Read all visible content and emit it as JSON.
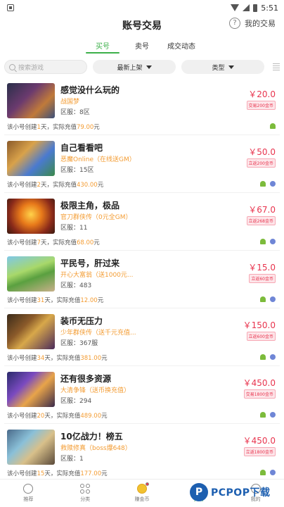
{
  "status_bar": {
    "time": "5:51"
  },
  "header": {
    "title": "账号交易",
    "help_label": "我的交易"
  },
  "tabs": [
    {
      "label": "买号",
      "active": true
    },
    {
      "label": "卖号",
      "active": false
    },
    {
      "label": "成交动态",
      "active": false
    }
  ],
  "filters": {
    "search_placeholder": "搜索游戏",
    "sort_label": "最新上架",
    "type_label": "类型"
  },
  "colors": {
    "accent": "#3cb04a",
    "price": "#e8344e",
    "highlight": "#f39c33"
  },
  "listings": [
    {
      "title": "感觉没什么玩的",
      "game": "战国梦",
      "server": "区服：8区",
      "created_a": "该小号创建",
      "days": "1",
      "created_b": "天，实际充值",
      "recharge": "79.00",
      "created_c": "元",
      "price": "￥20.0",
      "coins": "交易200金币",
      "android": true,
      "ios": false
    },
    {
      "title": "自己看看吧",
      "game": "恶魔Online（在线送GM）",
      "server": "区服：15区",
      "created_a": "该小号创建",
      "days": "2",
      "created_b": "天，实际充值",
      "recharge": "430.00",
      "created_c": "元",
      "price": "￥50.0",
      "coins": "立返200金币",
      "android": true,
      "ios": true
    },
    {
      "title": "极限主角，极品",
      "game": "官刀群侠传（0元全GM）",
      "server": "区服：11",
      "created_a": "该小号创建",
      "days": "7",
      "created_b": "天，实际充值",
      "recharge": "68.00",
      "created_c": "元",
      "price": "￥67.0",
      "coins": "立返268金币",
      "android": true,
      "ios": true
    },
    {
      "title": "平民号，肝过来",
      "game": "开心大富翁（送1000元...",
      "server": "区服：483",
      "created_a": "该小号创建",
      "days": "31",
      "created_b": "天，实际充值",
      "recharge": "12.00",
      "created_c": "元",
      "price": "￥15.0",
      "coins": "立返60金币",
      "android": true,
      "ios": true
    },
    {
      "title": "装币无压力",
      "game": "少年群侠传（送千元充值...",
      "server": "区服：367服",
      "created_a": "该小号创建",
      "days": "34",
      "created_b": "天，实际充值",
      "recharge": "381.00",
      "created_c": "元",
      "price": "￥150.0",
      "coins": "立返600金币",
      "android": true,
      "ios": true
    },
    {
      "title": "还有很多资源",
      "game": "大清争锋（送币换充值）",
      "server": "区服：294",
      "created_a": "该小号创建",
      "days": "20",
      "created_b": "天，实际充值",
      "recharge": "489.00",
      "created_c": "元",
      "price": "￥450.0",
      "coins": "交易1800金币",
      "android": true,
      "ios": true
    },
    {
      "title": "10亿战力！榜五",
      "game": "救赎修真（boss爆648）",
      "server": "区服：1",
      "created_a": "该小号创建",
      "days": "15",
      "created_b": "天，实际充值",
      "recharge": "177.00",
      "created_c": "元",
      "price": "￥450.0",
      "coins": "立返1800金币",
      "android": true,
      "ios": true
    }
  ],
  "nav": [
    {
      "label": "推荐",
      "icon": "recommend-icon"
    },
    {
      "label": "分类",
      "icon": "category-icon"
    },
    {
      "label": "赚金币",
      "icon": "coin-icon"
    },
    {
      "label": "交易",
      "icon": "trade-icon"
    },
    {
      "label": "我的",
      "icon": "user-icon"
    }
  ],
  "watermark": {
    "text": "PCPOP下载",
    "logo": "P"
  }
}
